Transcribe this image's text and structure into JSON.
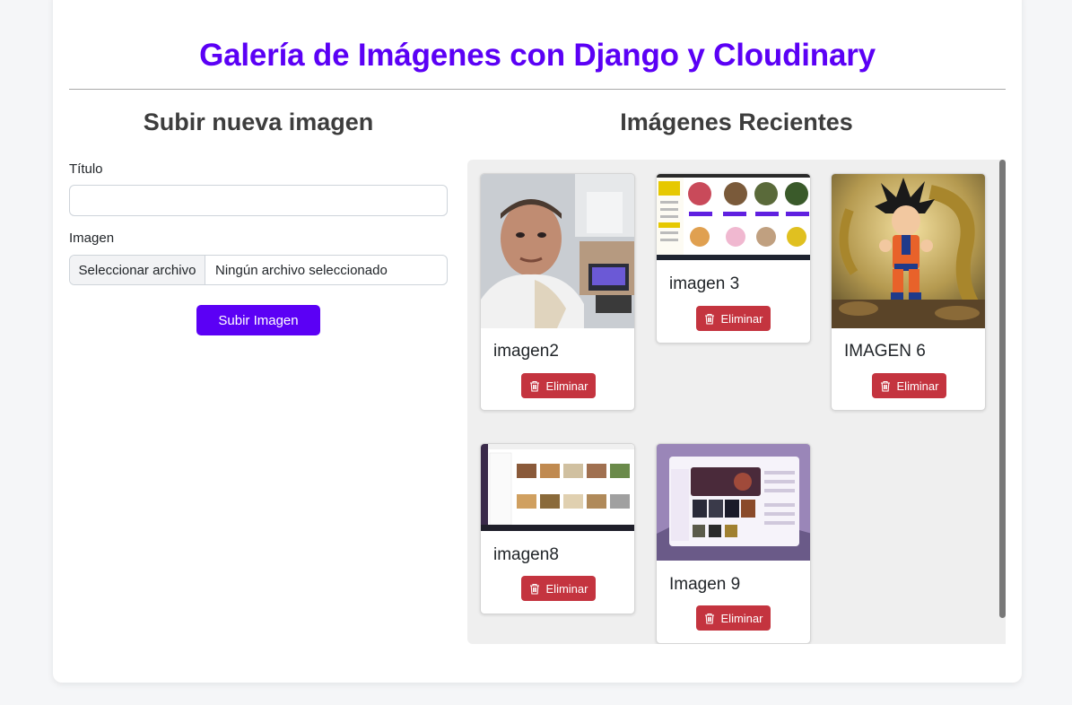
{
  "header": {
    "title": "Galería de Imágenes con Django y Cloudinary"
  },
  "upload": {
    "section_title": "Subir nueva imagen",
    "title_label": "Título",
    "title_value": "",
    "image_label": "Imagen",
    "file_button_label": "Seleccionar archivo",
    "file_status": "Ningún archivo seleccionado",
    "submit_label": "Subir Imagen"
  },
  "gallery": {
    "section_title": "Imágenes Recientes",
    "delete_label": "Eliminar",
    "cards": [
      {
        "title": "imagen2",
        "thumbnail": "selfie-photo"
      },
      {
        "title": "imagen 3",
        "thumbnail": "bakery-website-screenshot"
      },
      {
        "title": "IMAGEN 6",
        "thumbnail": "goku-dragon-artwork"
      },
      {
        "title": "imagen8",
        "thumbnail": "food-gallery-screenshot"
      },
      {
        "title": "Imagen 9",
        "thumbnail": "music-app-screenshot"
      }
    ]
  },
  "colors": {
    "accent": "#5b00f5",
    "danger": "#c4343f",
    "gallery_bg": "#efefef",
    "page_bg": "#f5f6f8"
  }
}
